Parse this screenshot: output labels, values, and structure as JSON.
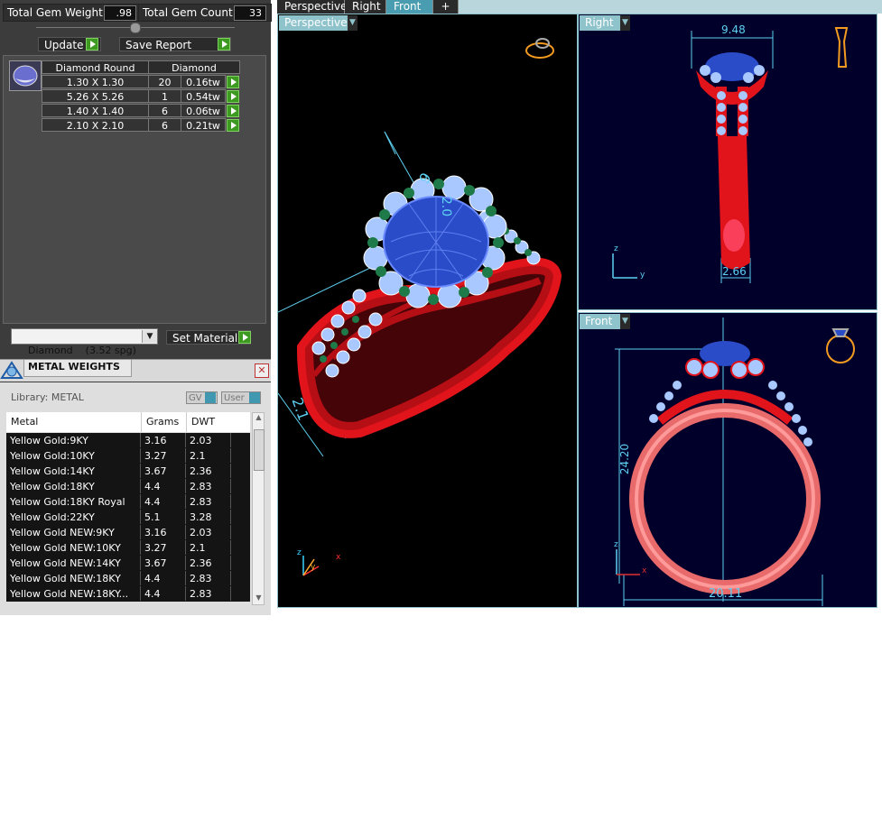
{
  "summary": {
    "weight_label": "Total Gem Weight",
    "weight_value": ".98",
    "count_label": "Total Gem Count",
    "count_value": "33"
  },
  "actions": {
    "update": "Update",
    "save_report": "Save Report"
  },
  "gem_table": {
    "headers": [
      "Diamond Round",
      "Diamond"
    ],
    "rows": [
      {
        "size": "1.30 X 1.30",
        "count": "20",
        "weight": "0.16tw"
      },
      {
        "size": "5.26 X 5.26",
        "count": "1",
        "weight": "0.54tw"
      },
      {
        "size": "1.40 X 1.40",
        "count": "6",
        "weight": "0.06tw"
      },
      {
        "size": "2.10 X 2.10",
        "count": "6",
        "weight": "0.21tw"
      }
    ]
  },
  "material": {
    "selected": "Diamond    (3.52 spg)",
    "set_label": "Set Material"
  },
  "metal_weights": {
    "title": "METAL WEIGHTS",
    "library": "Library: METAL",
    "gv_label": "GV",
    "user_label": "User",
    "columns": [
      "Metal",
      "Grams",
      "DWT"
    ],
    "rows": [
      {
        "metal": "Yellow Gold:9KY",
        "grams": "3.16",
        "dwt": "2.03"
      },
      {
        "metal": "Yellow Gold:10KY",
        "grams": "3.27",
        "dwt": "2.1"
      },
      {
        "metal": "Yellow Gold:14KY",
        "grams": "3.67",
        "dwt": "2.36"
      },
      {
        "metal": "Yellow Gold:18KY",
        "grams": "4.4",
        "dwt": "2.83"
      },
      {
        "metal": "Yellow Gold:18KY Royal",
        "grams": "4.4",
        "dwt": "2.83"
      },
      {
        "metal": "Yellow Gold:22KY",
        "grams": "5.1",
        "dwt": "3.28"
      },
      {
        "metal": "Yellow Gold NEW:9KY",
        "grams": "3.16",
        "dwt": "2.03"
      },
      {
        "metal": "Yellow Gold NEW:10KY",
        "grams": "3.27",
        "dwt": "2.1"
      },
      {
        "metal": "Yellow Gold NEW:14KY",
        "grams": "3.67",
        "dwt": "2.36"
      },
      {
        "metal": "Yellow Gold NEW:18KY",
        "grams": "4.4",
        "dwt": "2.83"
      },
      {
        "metal": "Yellow Gold NEW:18KY...",
        "grams": "4.4",
        "dwt": "2.83"
      }
    ]
  },
  "tabs": [
    "Perspective",
    "Right",
    "Front",
    "+"
  ],
  "viewports": {
    "perspective": {
      "label": "Perspective",
      "dims": [
        "9",
        "2.0",
        "2.1"
      ]
    },
    "right": {
      "label": "Right",
      "dims": [
        "9.48",
        "2.66"
      ]
    },
    "front": {
      "label": "Front",
      "dims": [
        "24.20",
        "20.11"
      ]
    }
  },
  "axes": {
    "x": "x",
    "y": "y",
    "z": "z"
  },
  "colors": {
    "panel": "#3c3c3c",
    "viewport_bg_dark": "#000000",
    "viewport_bg_navy": "#00002a",
    "accent": "#8fc3cc",
    "metal_red": "#e0141a",
    "diamond": "#a8c8ff",
    "sapphire": "#2a4cc8",
    "prong": "#1f7a4a",
    "go_button": "#3d9a20"
  }
}
